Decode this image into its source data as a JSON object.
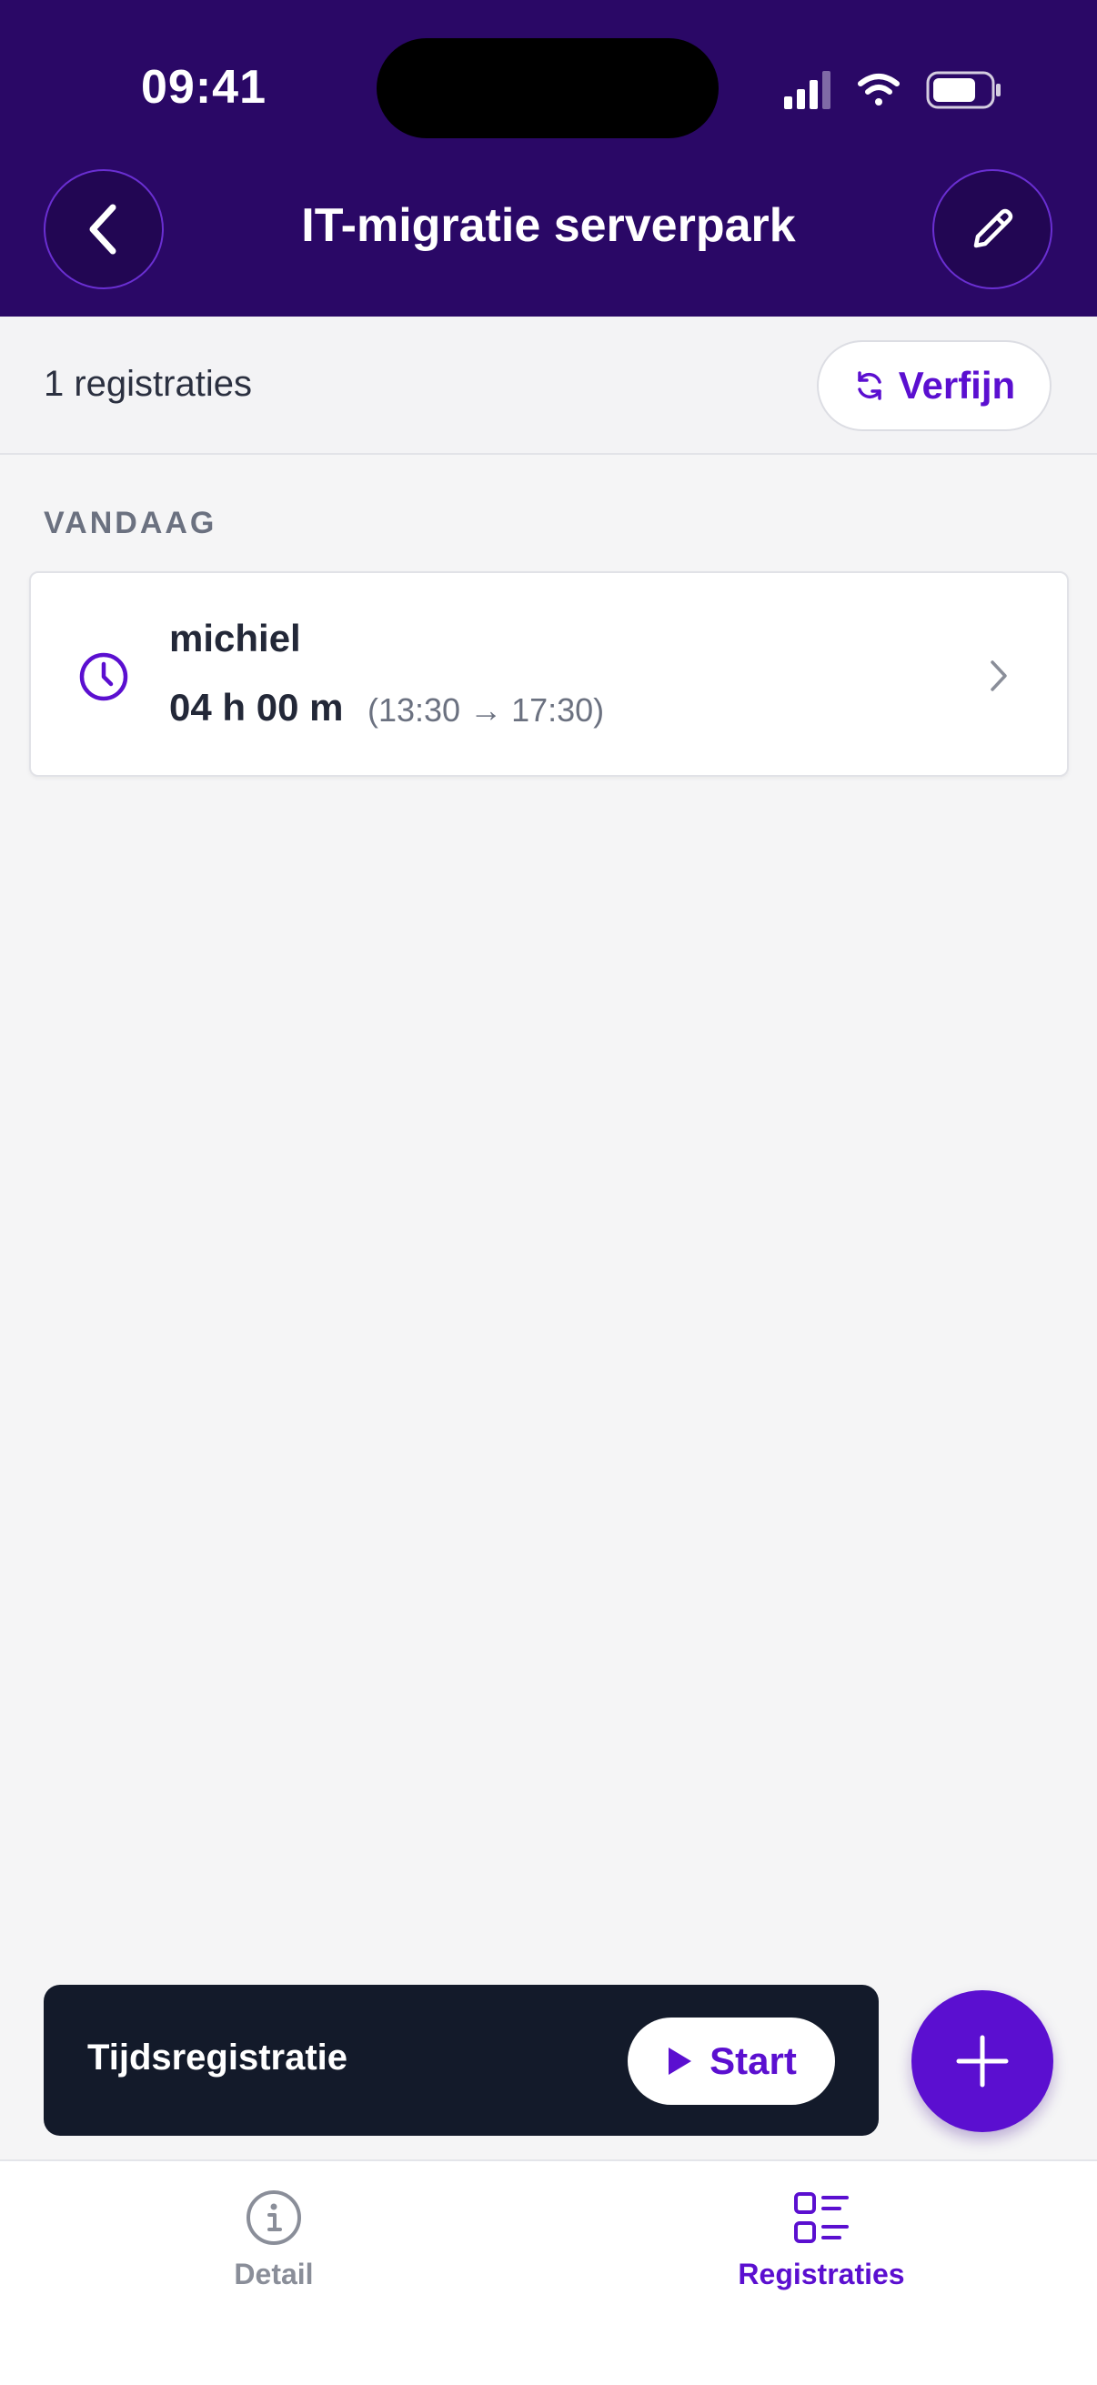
{
  "status_bar": {
    "time": "09:41"
  },
  "header": {
    "title": "IT-migratie serverpark"
  },
  "subbar": {
    "count_text": "1 registraties",
    "refine_label": "Verfijn"
  },
  "section": {
    "label": "VANDAAG"
  },
  "entries": [
    {
      "name": "michiel",
      "duration": "04 h 00 m",
      "range": "(13:30 → 17:30)"
    }
  ],
  "timer": {
    "label": "Tijdsregistratie",
    "start_label": "Start"
  },
  "tabs": [
    {
      "label": "Detail",
      "icon": "info-icon",
      "active": false
    },
    {
      "label": "Registraties",
      "icon": "list-icon",
      "active": true
    }
  ],
  "colors": {
    "brand": "#5b0fd0",
    "header_bg": "#2a0866",
    "timer_bg": "#131a2a"
  }
}
